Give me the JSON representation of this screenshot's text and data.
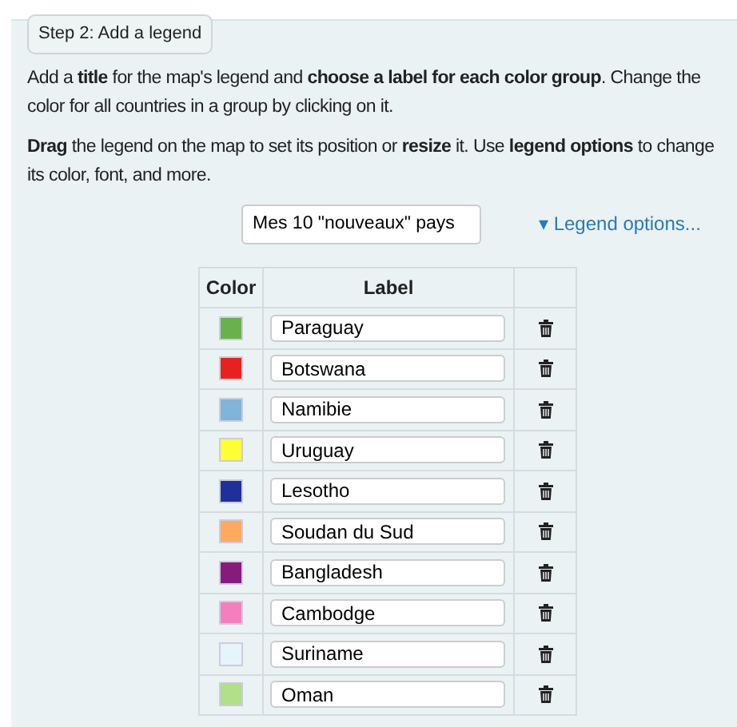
{
  "step_label": "Step 2: Add a legend",
  "paragraphs": [
    "Add a **title** for the map's legend and **choose a label for each color group**. Change the color for all countries in a group by clicking on it.",
    "**Drag** the legend on the map to set its position or **resize** it. Use **legend options** to change its color, font, and more."
  ],
  "legend_title": "Mes 10 \"nouveaux\" pays",
  "options_link": {
    "caret": "▾",
    "label": "Legend options...",
    "expanded": false
  },
  "table": {
    "columns": [
      "Color",
      "Label"
    ],
    "rows": [
      {
        "color": "#6ab04c",
        "label": "Paraguay"
      },
      {
        "color": "#e8211f",
        "label": "Botswana"
      },
      {
        "color": "#80b4d8",
        "label": "Namibie"
      },
      {
        "color": "#ffff33",
        "label": "Uruguay"
      },
      {
        "color": "#20309a",
        "label": "Lesotho"
      },
      {
        "color": "#fdaa5f",
        "label": "Soudan du Sud"
      },
      {
        "color": "#861b7e",
        "label": "Bangladesh"
      },
      {
        "color": "#f57fbe",
        "label": "Cambodge"
      },
      {
        "color": "#e6f5fb",
        "label": "Suriname"
      },
      {
        "color": "#b2df8a",
        "label": "Oman"
      }
    ]
  }
}
